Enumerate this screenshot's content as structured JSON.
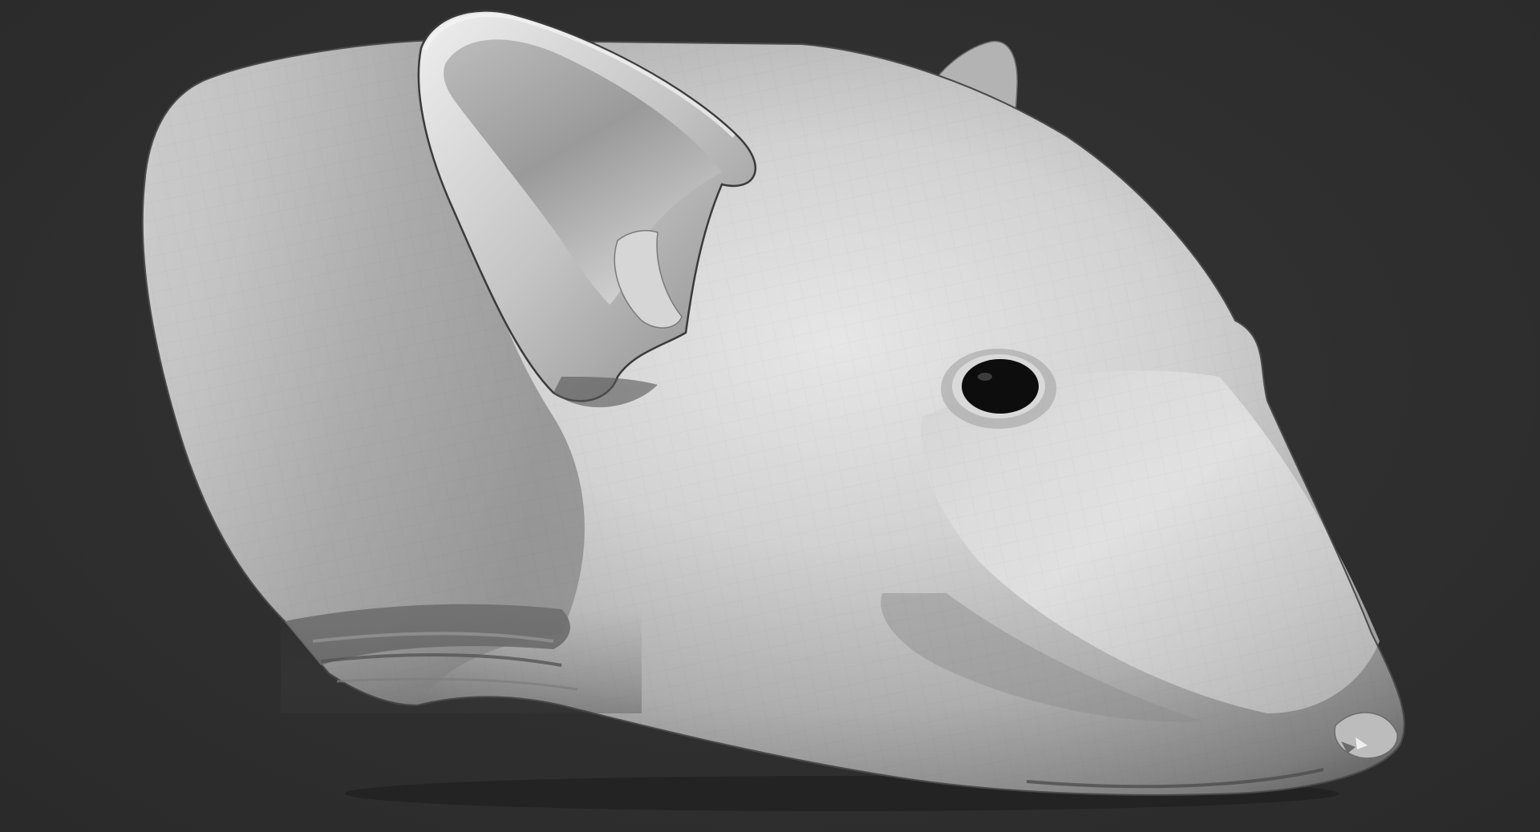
{
  "scene": {
    "background_color": "#2f2f2f",
    "model_color": "#c8c8c8",
    "subject": "rat-head-sculpt",
    "material": "matcap-gray",
    "topology": "visible-polygon-faceting"
  }
}
